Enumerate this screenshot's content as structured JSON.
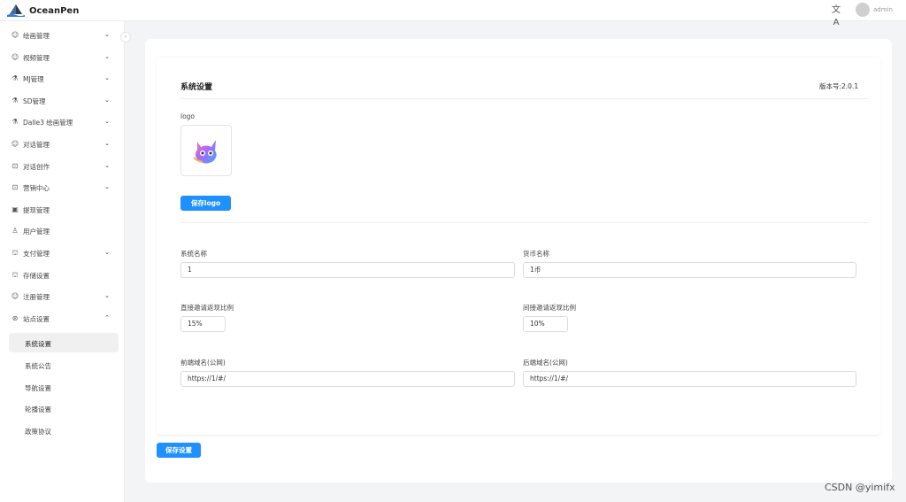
{
  "app": {
    "name": "OceanPen"
  },
  "header": {
    "username": "admin",
    "translate_icon": "文A"
  },
  "sidebar": {
    "items": [
      {
        "label": "绘画管理",
        "icon": "chat-icon",
        "glyph": "☺",
        "arrow": "⌄"
      },
      {
        "label": "视频管理",
        "icon": "chat-icon",
        "glyph": "☺",
        "arrow": "⌄"
      },
      {
        "label": "MJ管理",
        "icon": "flask-icon",
        "glyph": "⚗",
        "arrow": "⌄"
      },
      {
        "label": "SD管理",
        "icon": "flask-icon",
        "glyph": "⚗",
        "arrow": "⌄"
      },
      {
        "label": "Dalle3 绘画管理",
        "icon": "flask-icon",
        "glyph": "⚗",
        "arrow": "⌄"
      },
      {
        "label": "对话管理",
        "icon": "chat-icon",
        "glyph": "☺",
        "arrow": "⌄"
      },
      {
        "label": "对话创作",
        "icon": "grid-icon",
        "glyph": "⊡",
        "arrow": "⌄"
      },
      {
        "label": "营销中心",
        "icon": "grid-icon",
        "glyph": "⊡",
        "arrow": "⌄"
      },
      {
        "label": "提现管理",
        "icon": "wallet-icon",
        "glyph": "▣",
        "arrow": ""
      },
      {
        "label": "用户管理",
        "icon": "user-icon",
        "glyph": "♙",
        "arrow": ""
      },
      {
        "label": "支付管理",
        "icon": "bag-icon",
        "glyph": "⛫",
        "arrow": "⌄"
      },
      {
        "label": "存储设置",
        "icon": "bag-icon",
        "glyph": "⛫",
        "arrow": ""
      },
      {
        "label": "注册管理",
        "icon": "chat-icon",
        "glyph": "☺",
        "arrow": "⌄"
      },
      {
        "label": "站点设置",
        "icon": "site-icon",
        "glyph": "⊛",
        "arrow": "⌃"
      }
    ],
    "sub_items": [
      {
        "label": "系统设置",
        "active": true
      },
      {
        "label": "系统公告",
        "active": false
      },
      {
        "label": "导航设置",
        "active": false
      },
      {
        "label": "轮播设置",
        "active": false
      },
      {
        "label": "政策协议",
        "active": false
      }
    ],
    "collapse_glyph": "‹"
  },
  "main": {
    "title": "系统设置",
    "version": "版本号:2.0.1",
    "logo_label": "logo",
    "save_logo_label": "保存logo",
    "fields": {
      "system_name": {
        "label": "系统名称",
        "value": "1"
      },
      "currency_name": {
        "label": "货币名称",
        "value": "1币"
      },
      "direct_invite": {
        "label": "直接邀请返现比例",
        "value": "15%"
      },
      "indirect_invite": {
        "label": "间接邀请返现比例",
        "value": "10%"
      },
      "frontend_domain": {
        "label": "前端域名(公网)",
        "value": "https://1/#/"
      },
      "backend_domain": {
        "label": "后端域名(公网)",
        "value": "https://1/#/"
      }
    },
    "save_settings_label": "保存设置"
  },
  "watermark": "CSDN @yimifx",
  "colors": {
    "primary": "#1e90ff",
    "background": "#f3f4f6"
  }
}
